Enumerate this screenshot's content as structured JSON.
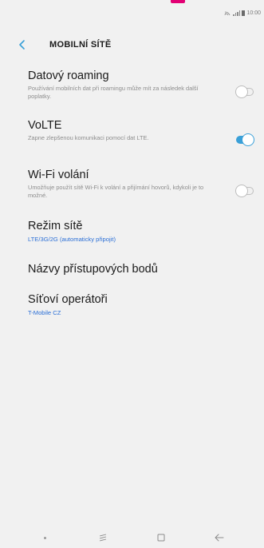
{
  "colors": {
    "brand_accent": "#e20074",
    "toggle_on": "#3aa0d8",
    "link_blue": "#2b6fd6",
    "background": "#f1f1f1"
  },
  "status_bar": {
    "time": "10:00",
    "icons": [
      "cast-icon",
      "signal-icon",
      "battery-icon"
    ]
  },
  "header": {
    "back_icon": "chevron-left-icon",
    "title": "MOBILNÍ SÍTĚ"
  },
  "settings": {
    "roaming": {
      "title": "Datový roaming",
      "description": "Používání mobilních dat při roamingu může mít za následek další poplatky.",
      "enabled": false
    },
    "volte": {
      "title": "VoLTE",
      "description": "Zapne zlepšenou komunikaci pomocí dat LTE.",
      "enabled": true
    },
    "wifi_calling": {
      "title": "Wi-Fi volání",
      "description": "Umožňuje použít sítě Wi-Fi k volání a přijímání hovorů, kdykoli je to možné.",
      "enabled": false
    },
    "network_mode": {
      "title": "Režim sítě",
      "value": "LTE/3G/2G (automaticky připojit)"
    },
    "apn": {
      "title": "Názvy přístupových bodů"
    },
    "operators": {
      "title": "Síťoví operátoři",
      "value": "T-Mobile CZ"
    }
  },
  "nav_bar": {
    "items": [
      "dot-icon",
      "recent-apps-icon",
      "home-icon",
      "back-arrow-icon"
    ]
  }
}
